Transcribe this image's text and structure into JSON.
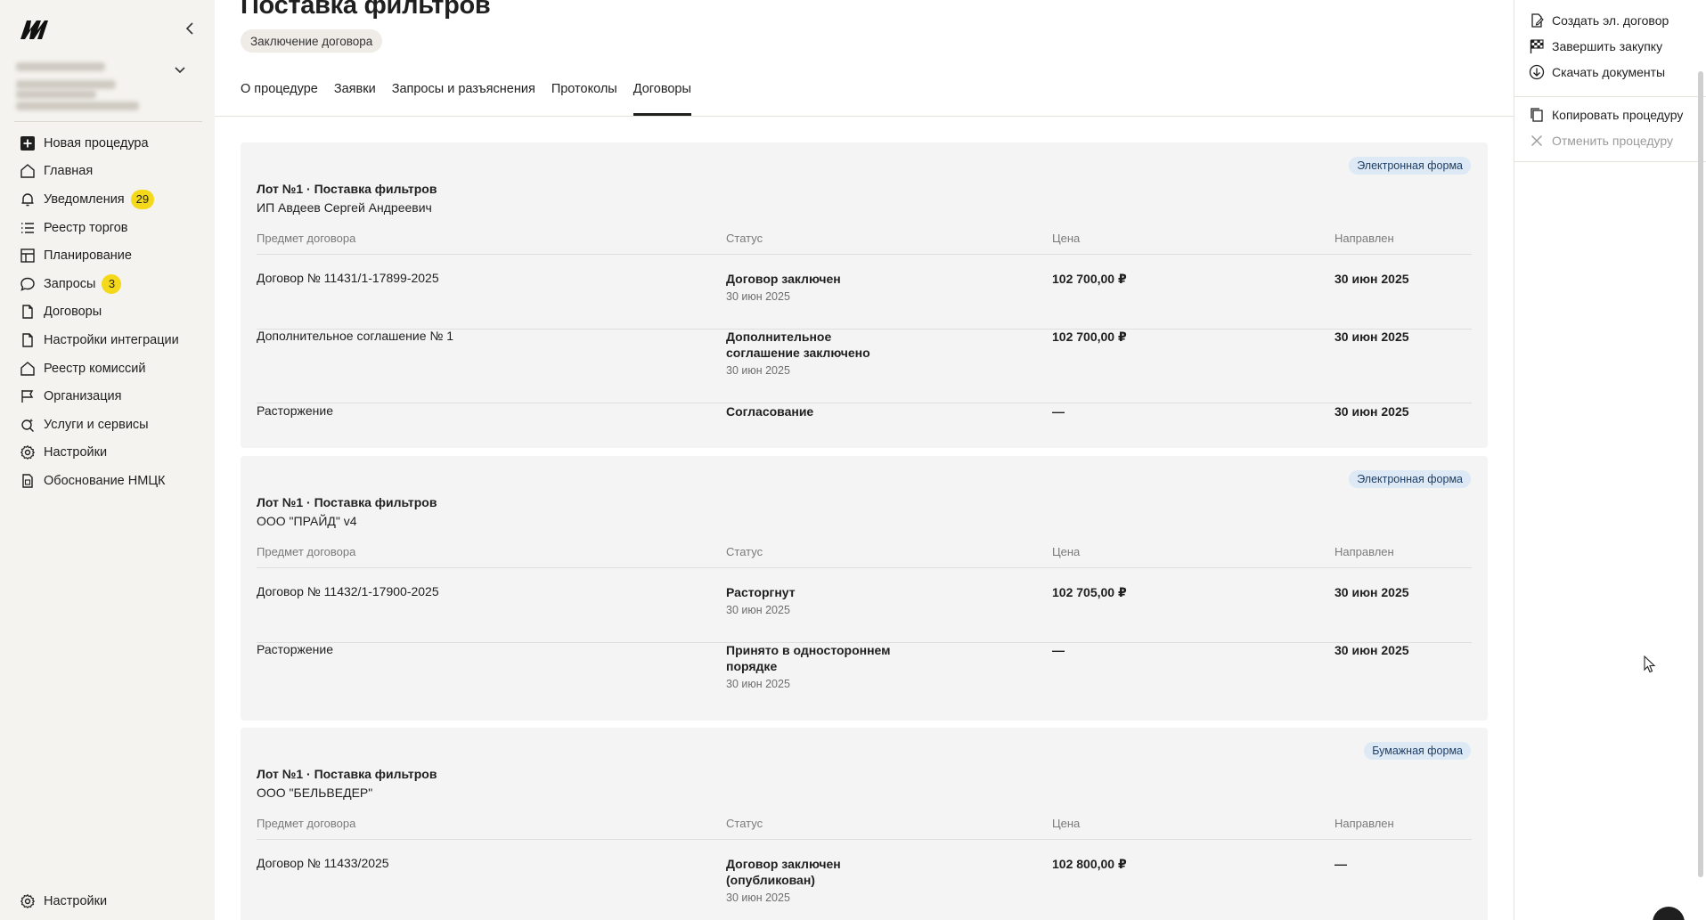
{
  "sidebar": {
    "nav": [
      {
        "label": "Новая процедура",
        "icon": "plus-square-icon"
      },
      {
        "label": "Главная",
        "icon": "home-icon"
      },
      {
        "label": "Уведомления",
        "icon": "bell-icon",
        "badge": "29"
      },
      {
        "label": "Реестр торгов",
        "icon": "list-icon"
      },
      {
        "label": "Планирование",
        "icon": "table-icon"
      },
      {
        "label": "Запросы",
        "icon": "chat-icon",
        "badge": "3"
      },
      {
        "label": "Договоры",
        "icon": "document-icon"
      },
      {
        "label": "Настройки интеграции",
        "icon": "document-icon"
      },
      {
        "label": "Реестр комиссий",
        "icon": "home-icon"
      },
      {
        "label": "Организация",
        "icon": "flag-icon"
      },
      {
        "label": "Услуги и сервисы",
        "icon": "search-sparkle-icon"
      },
      {
        "label": "Настройки",
        "icon": "gear-icon"
      },
      {
        "label": "Обоснование НМЦК",
        "icon": "calculator-doc-icon"
      }
    ],
    "bottom": {
      "label": "Настройки",
      "icon": "gear-icon"
    }
  },
  "main": {
    "title": "Поставка фильтров",
    "status": "Заключение договора",
    "tabs": [
      "О процедуре",
      "Заявки",
      "Запросы и разъяснения",
      "Протоколы",
      "Договоры"
    ],
    "active_tab": "Договоры",
    "columns": [
      "Предмет договора",
      "Статус",
      "Цена",
      "Направлен"
    ],
    "cards": [
      {
        "form": "Электронная форма",
        "lot": "Лот №1 · Поставка фильтров",
        "supplier": "ИП Авдеев Сергей Андреевич",
        "rows": [
          {
            "subject": "Договор № 11431/1-17899-2025",
            "status": "Договор заключен",
            "status_date": "30 июн 2025",
            "price": "102 700,00 ₽",
            "sent": "30 июн 2025"
          },
          {
            "subject": "Дополнительное соглашение № 1",
            "status": "Дополнительное соглашение заключено",
            "status_date": "30 июн 2025",
            "price": "102 700,00 ₽",
            "sent": "30 июн 2025"
          },
          {
            "subject": "Расторжение",
            "status": "Согласование",
            "status_date": "",
            "price": "—",
            "sent": "30 июн 2025"
          }
        ]
      },
      {
        "form": "Электронная форма",
        "lot": "Лот №1 · Поставка фильтров",
        "supplier": "ООО \"ПРАЙД\" v4",
        "rows": [
          {
            "subject": "Договор № 11432/1-17900-2025",
            "status": "Расторгнут",
            "status_date": "30 июн 2025",
            "price": "102 705,00 ₽",
            "sent": "30 июн 2025"
          },
          {
            "subject": "Расторжение",
            "status": "Принято в одностороннем порядке",
            "status_date": "30 июн 2025",
            "price": "—",
            "sent": "30 июн 2025"
          }
        ]
      },
      {
        "form": "Бумажная форма",
        "lot": "Лот №1 · Поставка фильтров",
        "supplier": "ООО \"БЕЛЬВЕДЕР\"",
        "rows": [
          {
            "subject": "Договор № 11433/2025",
            "status": "Договор заключен (опубликован)",
            "status_date": "30 июн 2025",
            "price": "102 800,00 ₽",
            "sent": "—"
          }
        ]
      }
    ]
  },
  "actions": [
    {
      "label": "Создать эл. договор",
      "icon": "edit-doc-icon",
      "disabled": false
    },
    {
      "label": "Завершить закупку",
      "icon": "checkered-flag-icon",
      "disabled": false
    },
    {
      "label": "Скачать документы",
      "icon": "download-icon",
      "disabled": false
    },
    {
      "label": "Копировать процедуру",
      "icon": "copy-icon",
      "disabled": false
    },
    {
      "label": "Отменить процедуру",
      "icon": "close-icon",
      "disabled": true
    }
  ],
  "colors": {
    "sidebar_bg": "#f5f3ef",
    "card_bg": "#f4f4f4",
    "badge": "#f4d91a",
    "form_badge_bg": "#dde9f5"
  }
}
